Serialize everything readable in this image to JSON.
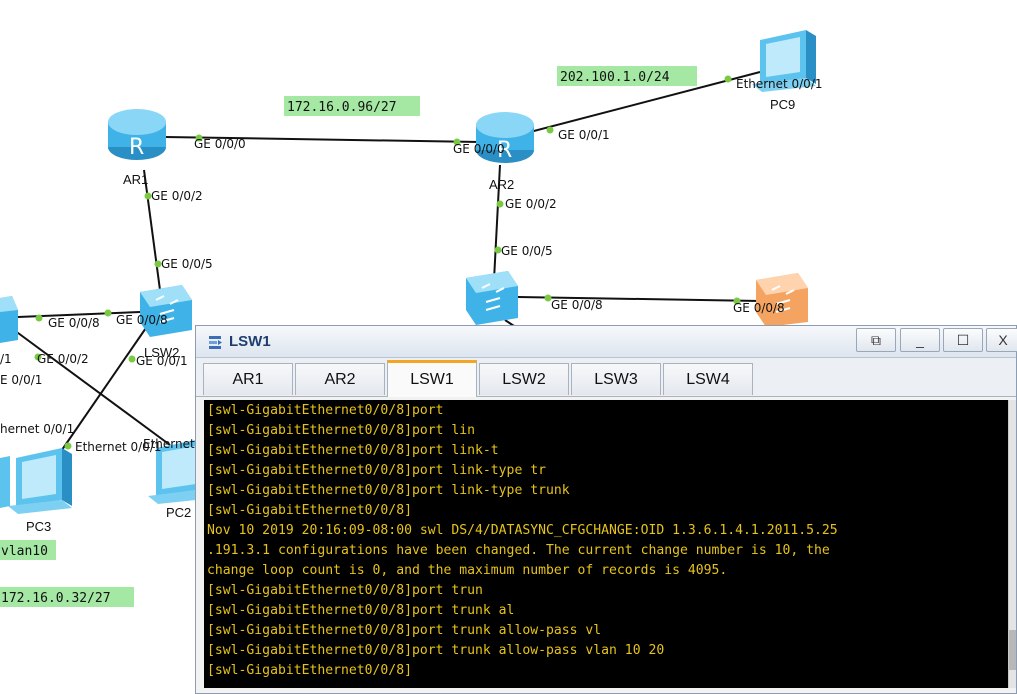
{
  "topology": {
    "subnets": {
      "ar1_ar2": "172.16.0.96/27",
      "ar2_pc9": "202.100.1.0/24",
      "vlan10_subnet": "172.16.0.32/27",
      "vlan10_tag": "vlan10"
    },
    "devices": {
      "ar1": "AR1",
      "ar2": "AR2",
      "lsw2": "LSW2",
      "pc9": "PC9",
      "pc3": "PC3",
      "pc2": "PC2"
    },
    "ports": {
      "ar1_ge000": "GE 0/0/0",
      "ar2_ge000": "GE 0/0/0",
      "ar2_ge001": "GE 0/0/1",
      "pc9_eth": "Ethernet 0/0/1",
      "ar1_ge002": "GE 0/0/2",
      "ar2_ge002": "GE 0/0/2",
      "lsw2_ge005": "GE 0/0/5",
      "lsw_right_ge005": "GE 0/0/5",
      "lsw_right_ge008": "GE 0/0/8",
      "lsw_orange_ge008": "GE 0/0/8",
      "lsw1_ge008": "GE 0/0/8",
      "lsw2_ge008": "GE 0/0/8",
      "lsw1_ge002": "GE 0/0/2",
      "lsw2_ge001": "GE 0/0/1",
      "lsw1_ge001": "E 0/0/1",
      "lsw1_port1": "/1",
      "pc3_eth": "hernet 0/0/1",
      "pc2_eth_a": "Ethernet 0/0/1",
      "pc2_eth_b": "Ethernet"
    }
  },
  "console": {
    "title": "LSW1",
    "window_buttons": {
      "restore": "⧉",
      "minimize": "_",
      "maximize": "☐",
      "close": "X"
    },
    "tabs": [
      "AR1",
      "AR2",
      "LSW1",
      "LSW2",
      "LSW3",
      "LSW4"
    ],
    "active_tab": "LSW1",
    "lines": [
      "[swl-GigabitEthernet0/0/8]port",
      "[swl-GigabitEthernet0/0/8]port lin",
      "[swl-GigabitEthernet0/0/8]port link-t",
      "[swl-GigabitEthernet0/0/8]port link-type tr",
      "[swl-GigabitEthernet0/0/8]port link-type trunk",
      "[swl-GigabitEthernet0/0/8]",
      "Nov 10 2019 20:16:09-08:00 swl DS/4/DATASYNC_CFGCHANGE:OID 1.3.6.1.4.1.2011.5.25",
      ".191.3.1 configurations have been changed. The current change number is 10, the",
      "change loop count is 0, and the maximum number of records is 4095.",
      "[swl-GigabitEthernet0/0/8]port trun",
      "[swl-GigabitEthernet0/0/8]port trunk al",
      "[swl-GigabitEthernet0/0/8]port trunk allow-pass vl",
      "[swl-GigabitEthernet0/0/8]port trunk allow-pass vlan 10 20",
      "[swl-GigabitEthernet0/0/8]"
    ]
  },
  "colors": {
    "link": "#111111",
    "port_dot": "#7ac943",
    "subnet_bg": "#a4e8a4",
    "router_blue": "#3fb3e8",
    "switch_blue": "#5cc2ee",
    "switch_orange": "#f4a460",
    "terminal_bg": "#000000",
    "terminal_fg": "#e6c31a",
    "active_tab_accent": "#f2a623"
  }
}
